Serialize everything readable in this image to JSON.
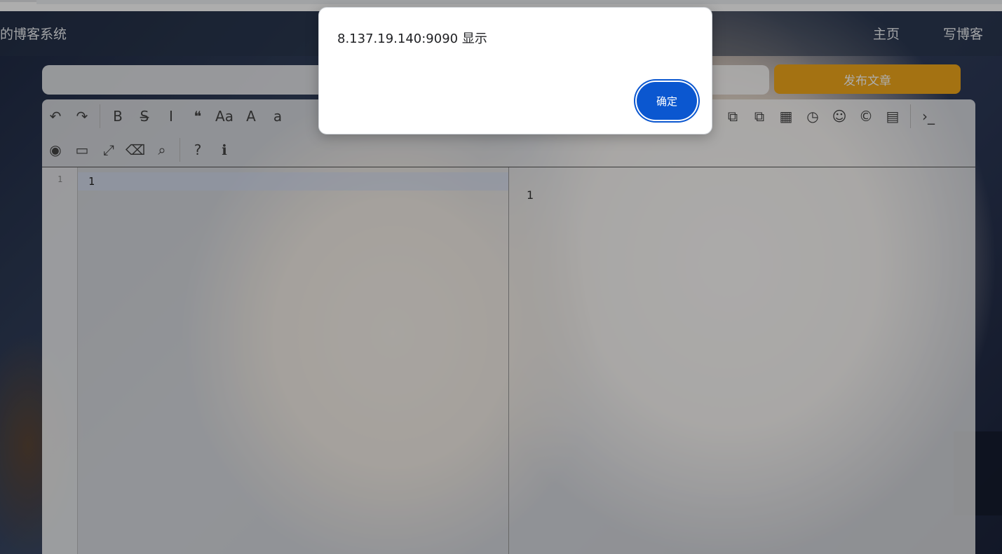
{
  "navbar": {
    "brand": "的博客系统",
    "home_label": "主页",
    "write_label": "写博客"
  },
  "editor": {
    "title_placeholder": "",
    "publish_label": "发布文章",
    "line_number": "1",
    "code_content": "1",
    "preview_content": "1",
    "toolbar_row1": [
      {
        "name": "undo-icon",
        "glyph": "↶"
      },
      {
        "name": "redo-icon",
        "glyph": "↷"
      },
      {
        "sep": true
      },
      {
        "name": "bold-icon",
        "glyph": "B"
      },
      {
        "name": "strikethrough-icon",
        "glyph": "S̶"
      },
      {
        "name": "italic-icon",
        "glyph": "I"
      },
      {
        "name": "quote-icon",
        "glyph": "❝"
      },
      {
        "name": "uppercase-icon",
        "glyph": "Aa"
      },
      {
        "name": "font-uppercase-icon",
        "glyph": "A"
      },
      {
        "name": "lowercase-icon",
        "glyph": "a"
      }
    ],
    "toolbar_right": [
      {
        "name": "code-file-icon",
        "glyph": "⧉"
      },
      {
        "name": "code-block-icon",
        "glyph": "⧉"
      },
      {
        "name": "table-icon",
        "glyph": "▦"
      },
      {
        "name": "datetime-icon",
        "glyph": "◷"
      },
      {
        "name": "emoji-icon",
        "glyph": "☺"
      },
      {
        "name": "html-entities-icon",
        "glyph": "©"
      },
      {
        "name": "pagebreak-icon",
        "glyph": "▤"
      },
      {
        "sep": true
      },
      {
        "name": "terminal-icon",
        "glyph": "›_"
      }
    ],
    "toolbar_row2": [
      {
        "name": "watch-toggle-icon",
        "glyph": "◉"
      },
      {
        "name": "preview-icon",
        "glyph": "▭"
      },
      {
        "name": "fullscreen-icon",
        "glyph": "⤢"
      },
      {
        "name": "clear-icon",
        "glyph": "⌫"
      },
      {
        "name": "search-icon",
        "glyph": "⌕"
      },
      {
        "sep": true
      },
      {
        "name": "help-icon",
        "glyph": "?"
      },
      {
        "name": "info-icon",
        "glyph": "ℹ"
      }
    ]
  },
  "dialog": {
    "message": "8.137.19.140:9090 显示",
    "ok_label": "确定"
  },
  "colors": {
    "accent": "#0b57d0",
    "publish": "#f2a81b"
  }
}
